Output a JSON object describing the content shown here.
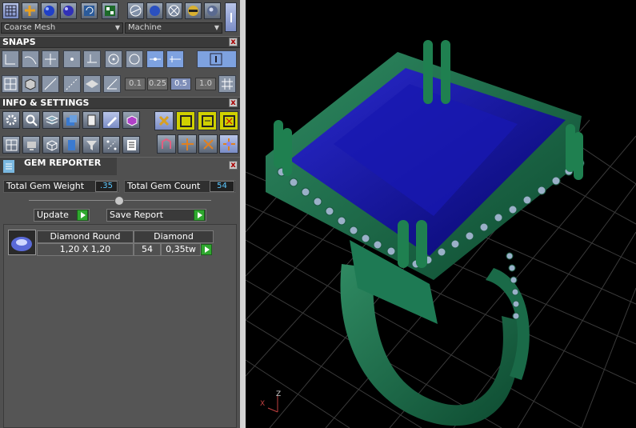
{
  "toolbar": {
    "mesh_select": "Coarse Mesh",
    "render_select": "Machine"
  },
  "snaps": {
    "title": "SNAPS",
    "step_values": [
      "0.1",
      "0.25",
      "0.5",
      "1.0"
    ],
    "selected_step": "0.5"
  },
  "info": {
    "title": "INFO & SETTINGS"
  },
  "gem_reporter": {
    "title": "GEM REPORTER",
    "total_weight_label": "Total Gem Weight",
    "total_weight_value": ".35",
    "total_count_label": "Total Gem Count",
    "total_count_value": "54",
    "update_label": "Update",
    "save_label": "Save Report",
    "gem_row": {
      "name": "Diamond Round",
      "material": "Diamond",
      "size": "1,20 X 1,20",
      "count": "54",
      "weight": "0,35tw"
    }
  },
  "viewport": {
    "axis_z": "Z",
    "axis_x": "X",
    "colors": {
      "metal": "#1f6b4a",
      "stone": "#10108a",
      "grid": "#3a3a3a"
    }
  }
}
